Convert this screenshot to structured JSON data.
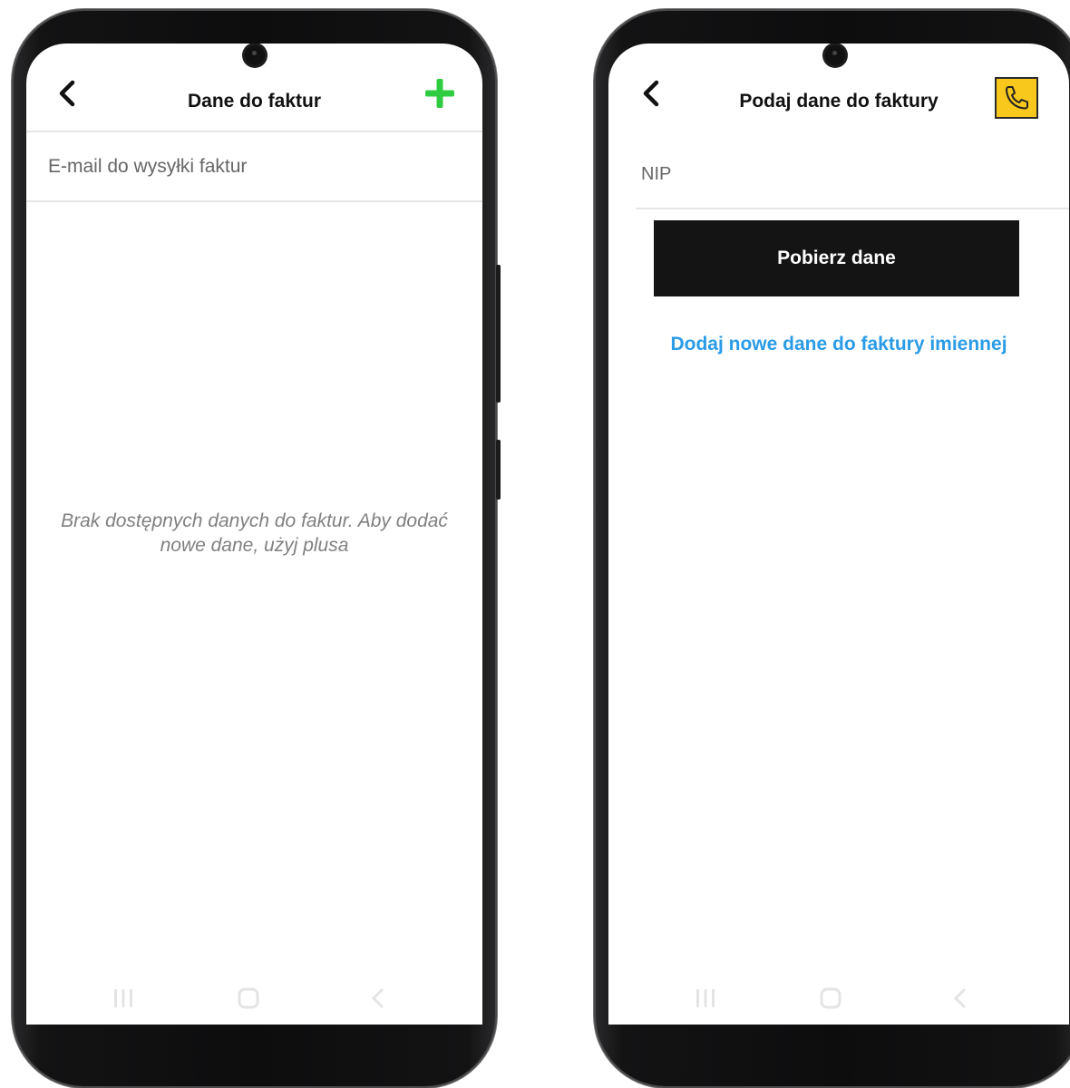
{
  "left_screen": {
    "title": "Dane do faktur",
    "back_icon": "chevron-left-icon",
    "add_icon": "plus-icon",
    "add_color": "#2ecc40",
    "email_label": "E-mail do wysyłki faktur",
    "empty_message": "Brak dostępnych danych do faktur. Aby dodać nowe dane, użyj plusa"
  },
  "right_screen": {
    "title": "Podaj dane do faktury",
    "back_icon": "chevron-left-icon",
    "call_icon": "phone-icon",
    "call_color": "#f8c81c",
    "nip_label": "NIP",
    "fetch_button": "Pobierz dane",
    "add_link": "Dodaj nowe dane do faktury imiennej",
    "link_color": "#2a9be6"
  },
  "navigation_bar": [
    "recent-apps-icon",
    "home-icon",
    "back-nav-icon"
  ]
}
